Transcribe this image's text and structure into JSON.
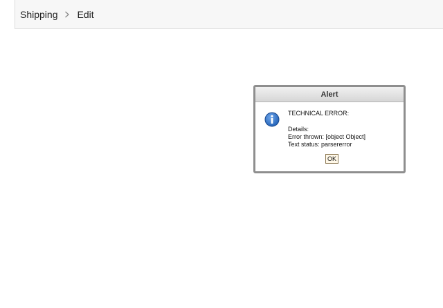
{
  "breadcrumb": {
    "items": [
      "Shipping",
      "Edit"
    ],
    "separator_icon": "chevron-right-icon"
  },
  "alert": {
    "title": "Alert",
    "icon": "info-icon",
    "lines": {
      "heading": "TECHNICAL ERROR:",
      "details": "Details:",
      "error_thrown": "Error thrown: [object Object]",
      "text_status": "Text status: parsererror"
    },
    "ok_label": "OK"
  },
  "colors": {
    "info_icon": "#1f5fb5",
    "dialog_border": "#8e8e8e",
    "breadcrumb_bg": "#f7f7f7"
  }
}
